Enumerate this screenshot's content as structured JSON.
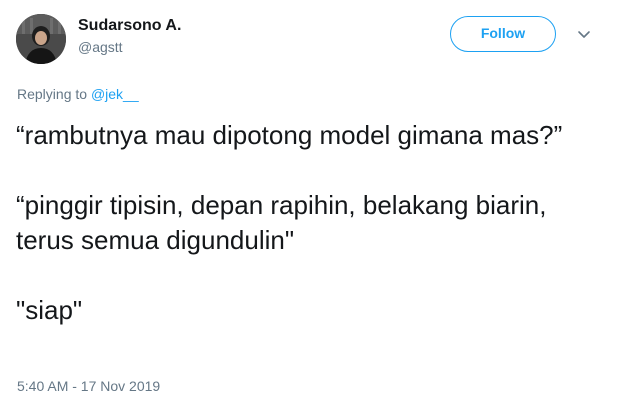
{
  "author": {
    "display_name": "Sudarsono A.",
    "handle": "@agstt",
    "avatar": "avatar-photo-icon"
  },
  "follow_button": {
    "label": "Follow",
    "color": "#1da1f2"
  },
  "menu_icon": "chevron-down-icon",
  "reply": {
    "prefix": "Replying to ",
    "mention": "@jek__"
  },
  "tweet": {
    "paragraphs": [
      "“rambutnya mau dipotong model gimana mas?”",
      "“pinggir tipisin, depan rapihin, belakang biarin, terus semua digundulin\"",
      "\"siap\""
    ]
  },
  "timestamp": "5:40 AM - 17 Nov 2019",
  "colors": {
    "accent": "#1da1f2",
    "text_primary": "#14171a",
    "text_secondary": "#657786"
  }
}
